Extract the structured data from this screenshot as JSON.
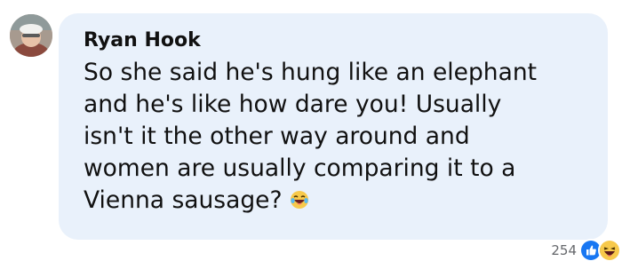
{
  "comment": {
    "author": "Ryan Hook",
    "text_lines": [
      "So she said he's hung like an elephant",
      "and he's like how dare you! Usually",
      "isn't it the other way around and",
      "women are usually comparing it to a",
      "Vienna sausage?"
    ],
    "inline_emoji": "laughing-tears-emoji",
    "avatar": "profile-photo",
    "colors": {
      "bubble": "#e9f1fb",
      "text": "#111111",
      "meta": "#65676b",
      "like_blue": "#1877f2",
      "haha_yellow": "#f7c94b"
    }
  },
  "reactions": {
    "count": "254",
    "icons": [
      "like-icon",
      "haha-icon"
    ]
  }
}
